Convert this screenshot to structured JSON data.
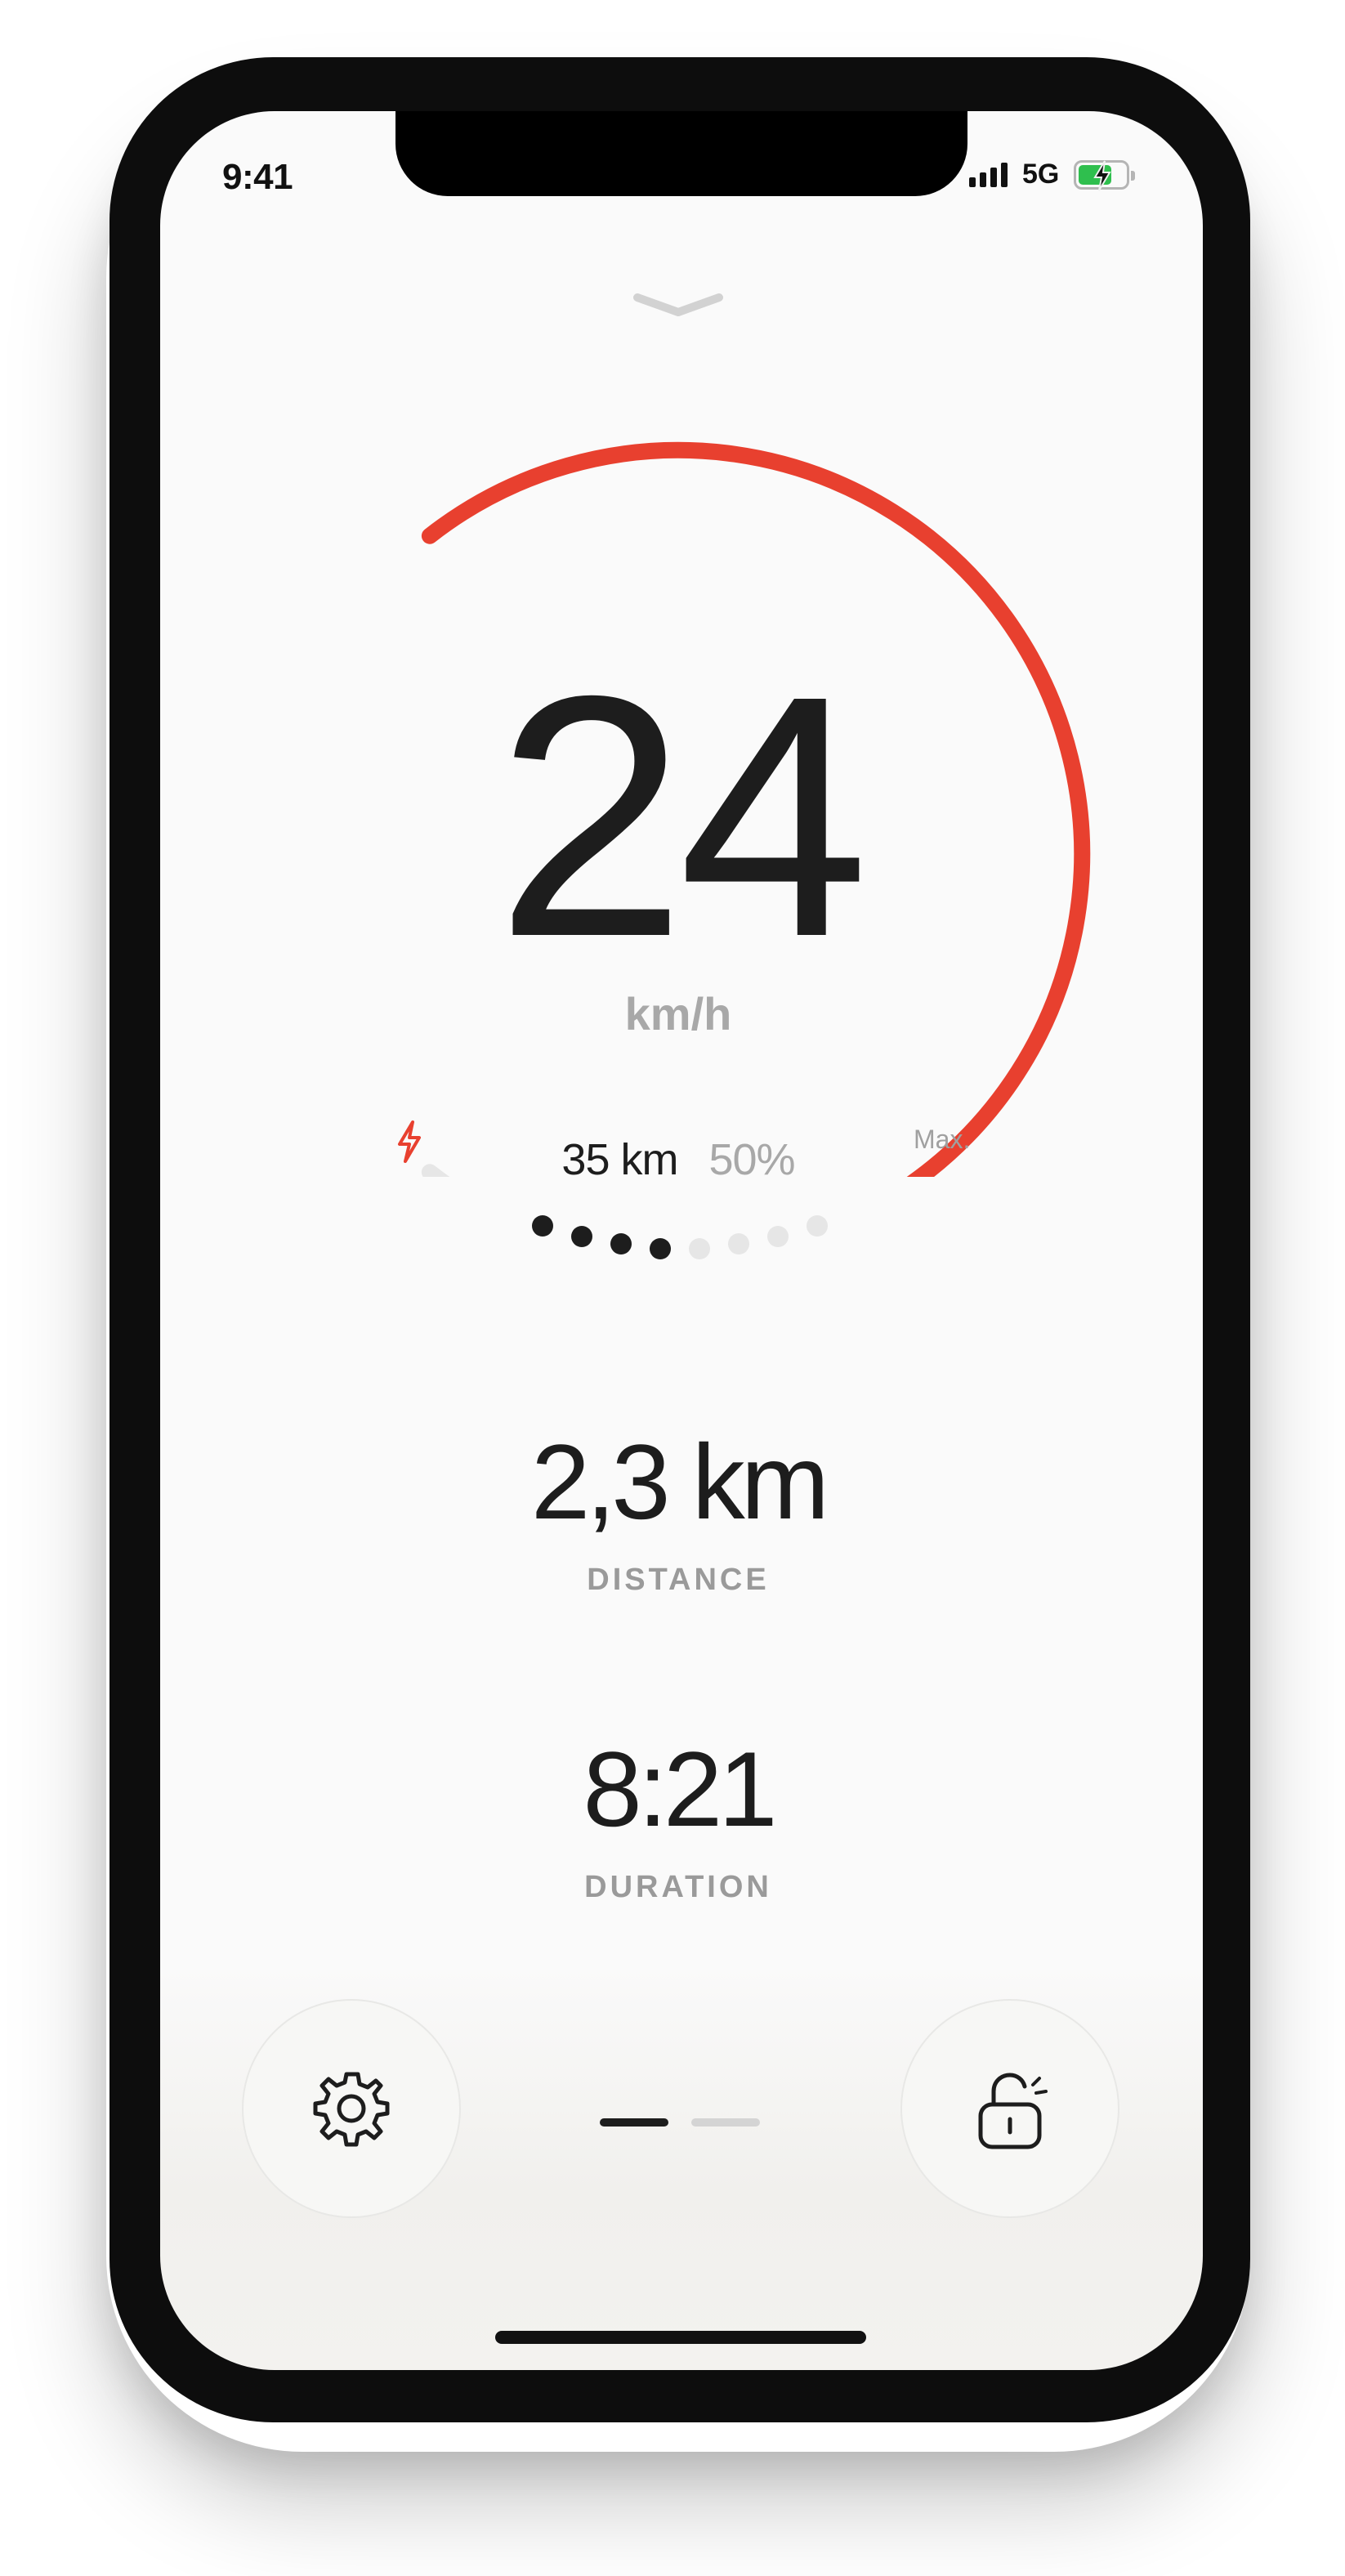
{
  "status_bar": {
    "time": "9:41",
    "network": "5G",
    "battery_level": 0.7
  },
  "speedometer": {
    "speed": "24",
    "unit": "km/h",
    "max_label": "Max.",
    "speed_fraction": 0.72,
    "accent_color": "#e8402f",
    "track_color": "#e6e6e6"
  },
  "range": {
    "distance": "35 km",
    "battery_percent": "50%",
    "dots_total": 8,
    "dots_filled": 4
  },
  "stats": {
    "distance_value": "2,3 km",
    "distance_label": "DISTANCE",
    "duration_value": "8:21",
    "duration_label": "DURATION"
  },
  "navigation": {
    "pages_total": 2,
    "active_page": 1
  },
  "icons": {
    "left_button": "gear-icon",
    "right_button": "unlock-icon",
    "handle": "chevron-down-icon",
    "boost": "bolt-icon"
  }
}
